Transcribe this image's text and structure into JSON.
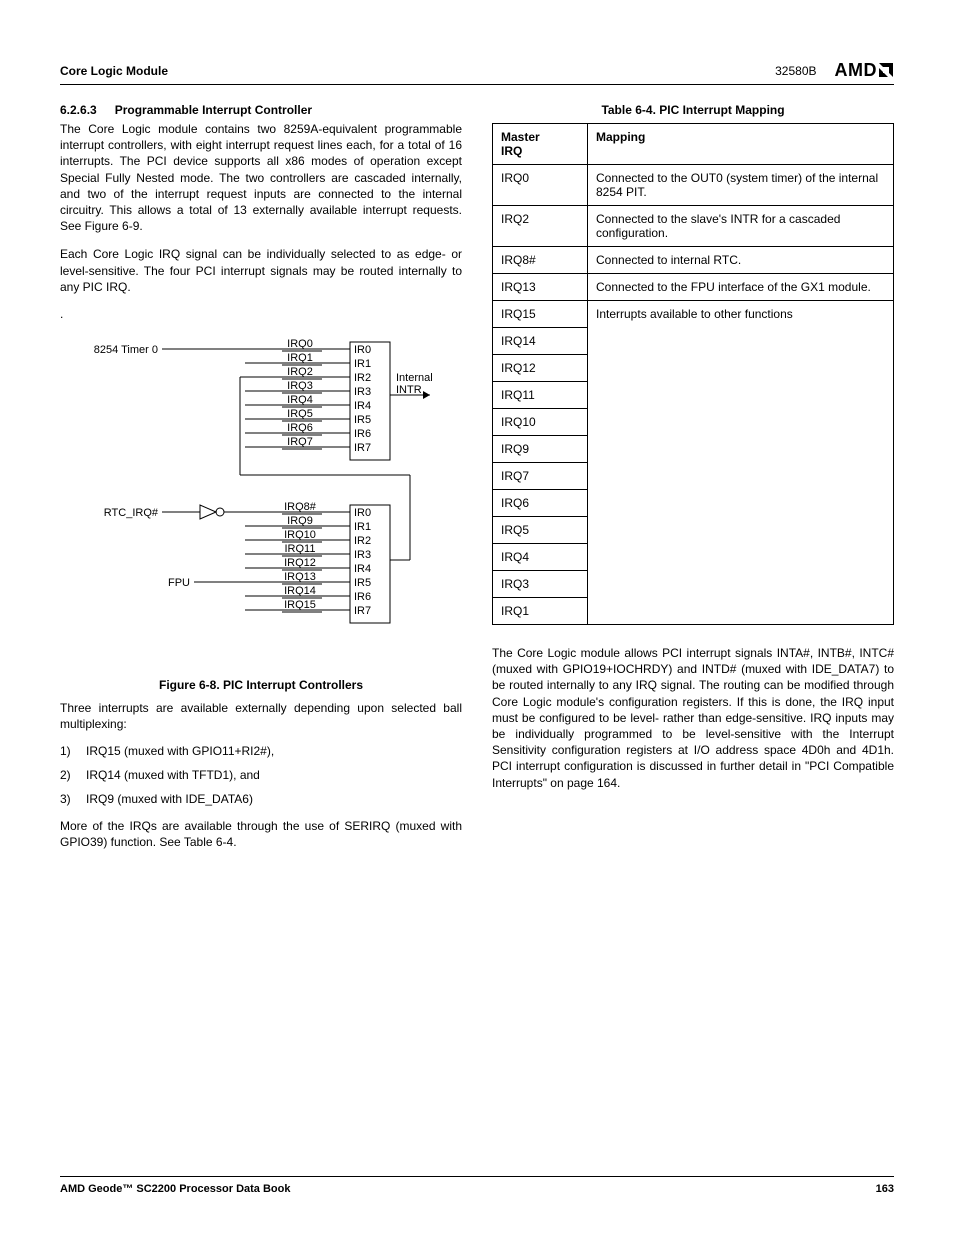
{
  "header": {
    "left": "Core Logic Module",
    "docnum": "32580B",
    "logo": "AMD"
  },
  "section": {
    "num": "6.2.6.3",
    "title": "Programmable Interrupt Controller",
    "p1": "The Core Logic module contains two 8259A-equivalent programmable interrupt controllers, with eight interrupt request lines each, for a total of 16 interrupts. The PCI device supports all x86 modes of operation except Special Fully Nested mode. The two controllers are cascaded internally, and two of the interrupt request inputs are connected to the internal circuitry. This allows a total of 13 externally available interrupt requests. See Figure 6-9.",
    "p2": "Each Core Logic IRQ signal can be individually selected to as edge- or level-sensitive. The four PCI interrupt signals may be routed internally to any PIC IRQ.",
    "p3": "Three interrupts are available externally depending upon selected ball multiplexing:",
    "list": [
      "IRQ15 (muxed with GPIO11+RI2#),",
      "IRQ14 (muxed with TFTD1), and",
      "IRQ9 (muxed with IDE_DATA6)"
    ],
    "p4": "More of the IRQs are available through the use of SERIRQ (muxed with GPIO39) function. See Table 6-4.",
    "p5": "The Core Logic module allows PCI interrupt signals INTA#, INTB#, INTC# (muxed with GPIO19+IOCHRDY) and INTD# (muxed with IDE_DATA7) to be routed internally to any IRQ signal. The routing can be modified through Core Logic module's configuration registers. If this is done, the IRQ input must be configured to be level- rather than edge-sensitive. IRQ inputs may be individually programmed to be level-sensitive with the Interrupt Sensitivity configuration registers at I/O address space 4D0h and 4D1h. PCI interrupt configuration is discussed in further detail in \"PCI Compatible Interrupts\" on page 164."
  },
  "figure": {
    "caption": "Figure 6-8.  PIC Interrupt Controllers",
    "labels": {
      "timer": "8254 Timer 0",
      "rtc": "RTC_IRQ#",
      "fpu": "FPU",
      "intr": "Internal INTR",
      "irq": [
        "IRQ0",
        "IRQ1",
        "IRQ2",
        "IRQ3",
        "IRQ4",
        "IRQ5",
        "IRQ6",
        "IRQ7"
      ],
      "irqb": [
        "IRQ8#",
        "IRQ9",
        "IRQ10",
        "IRQ11",
        "IRQ12",
        "IRQ13",
        "IRQ14",
        "IRQ15"
      ],
      "ir": [
        "IR0",
        "IR1",
        "IR2",
        "IR3",
        "IR4",
        "IR5",
        "IR6",
        "IR7"
      ]
    }
  },
  "table": {
    "caption": "Table 6-4.  PIC Interrupt Mapping",
    "head": {
      "c1": "Master IRQ",
      "c2": "Mapping"
    },
    "rows": [
      {
        "irq": "IRQ0",
        "map": "Connected to the OUT0 (system timer) of the internal 8254 PIT."
      },
      {
        "irq": "IRQ2",
        "map": "Connected to the slave's INTR for a cascaded configuration."
      },
      {
        "irq": "IRQ8#",
        "map": "Connected to internal RTC."
      },
      {
        "irq": "IRQ13",
        "map": "Connected to the FPU interface of the GX1 module."
      },
      {
        "irq": "IRQ15",
        "map": "Interrupts available to other functions"
      },
      {
        "irq": "IRQ14",
        "map": ""
      },
      {
        "irq": "IRQ12",
        "map": ""
      },
      {
        "irq": "IRQ11",
        "map": ""
      },
      {
        "irq": "IRQ10",
        "map": ""
      },
      {
        "irq": "IRQ9",
        "map": ""
      },
      {
        "irq": "IRQ7",
        "map": ""
      },
      {
        "irq": "IRQ6",
        "map": ""
      },
      {
        "irq": "IRQ5",
        "map": ""
      },
      {
        "irq": "IRQ4",
        "map": ""
      },
      {
        "irq": "IRQ3",
        "map": ""
      },
      {
        "irq": "IRQ1",
        "map": ""
      }
    ]
  },
  "footer": {
    "left": "AMD Geode™ SC2200  Processor Data Book",
    "right": "163"
  }
}
